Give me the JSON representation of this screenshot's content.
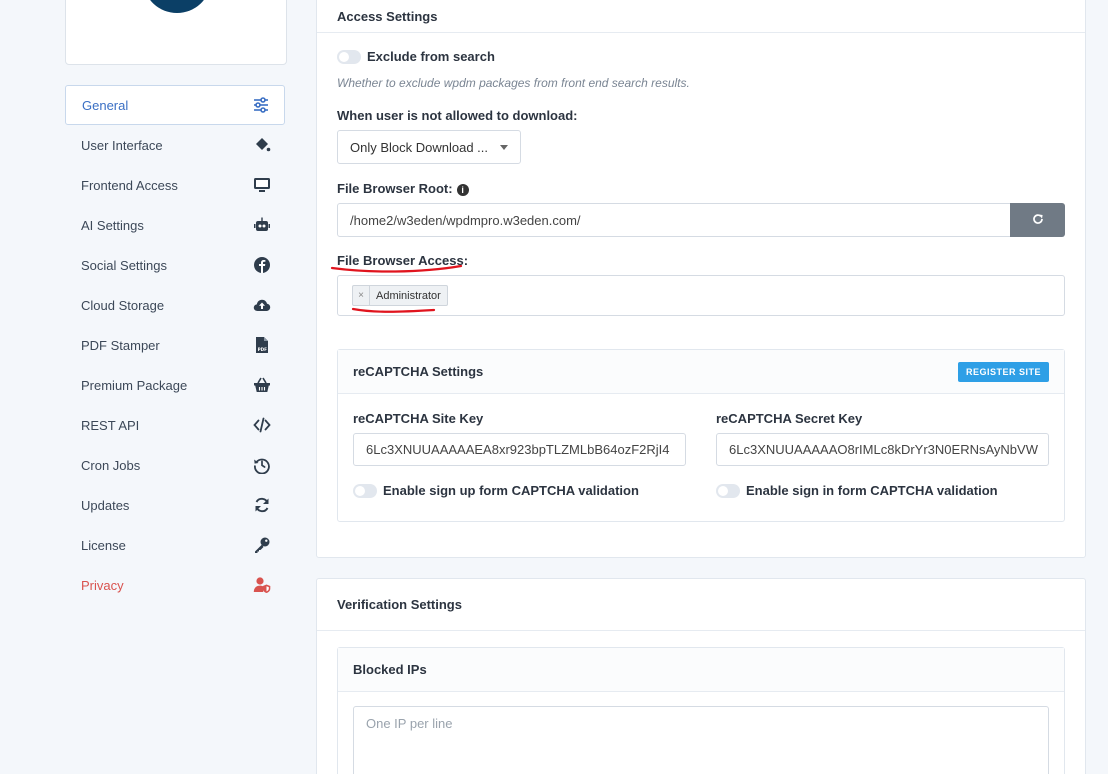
{
  "sidebar": {
    "items": [
      {
        "label": "General",
        "icon": "sliders-icon"
      },
      {
        "label": "User Interface",
        "icon": "paint-bucket-icon"
      },
      {
        "label": "Frontend Access",
        "icon": "monitor-icon"
      },
      {
        "label": "AI Settings",
        "icon": "robot-icon"
      },
      {
        "label": "Social Settings",
        "icon": "facebook-icon"
      },
      {
        "label": "Cloud Storage",
        "icon": "cloud-upload-icon"
      },
      {
        "label": "PDF Stamper",
        "icon": "pdf-file-icon"
      },
      {
        "label": "Premium Package",
        "icon": "basket-icon"
      },
      {
        "label": "REST API",
        "icon": "code-icon"
      },
      {
        "label": "Cron Jobs",
        "icon": "history-icon"
      },
      {
        "label": "Updates",
        "icon": "sync-icon"
      },
      {
        "label": "License",
        "icon": "key-icon"
      },
      {
        "label": "Privacy",
        "icon": "user-shield-icon"
      }
    ]
  },
  "access": {
    "title": "Access Settings",
    "exclude_label": "Exclude from search",
    "exclude_hint": "Whether to exclude wpdm packages from front end search results.",
    "not_allowed_label": "When user is not allowed to download:",
    "not_allowed_value": "Only Block Download ...",
    "browser_root_label": "File Browser Root:",
    "browser_root_value": "/home2/w3eden/wpdmpro.w3eden.com/",
    "browser_access_label": "File Browser Access:",
    "browser_access_tags": [
      "Administrator"
    ]
  },
  "recaptcha": {
    "title": "reCAPTCHA Settings",
    "register_label": "REGISTER SITE",
    "site_key_label": "reCAPTCHA Site Key",
    "site_key_value": "6Lc3XNUUAAAAAEA8xr923bpTLZMLbB64ozF2RjI4",
    "secret_key_label": "reCAPTCHA Secret Key",
    "secret_key_value": "6Lc3XNUUAAAAAO8rIMLc8kDrYr3N0ERNsAyNbVW",
    "signup_label": "Enable sign up form CAPTCHA validation",
    "signin_label": "Enable sign in form CAPTCHA validation"
  },
  "verification": {
    "title": "Verification Settings",
    "blocked_title": "Blocked IPs",
    "blocked_placeholder": "One IP per line"
  },
  "colors": {
    "active_nav": "#3a6fc4",
    "privacy": "#d9534f",
    "register_button": "#2e9fe6",
    "annotation": "#e0141e"
  }
}
